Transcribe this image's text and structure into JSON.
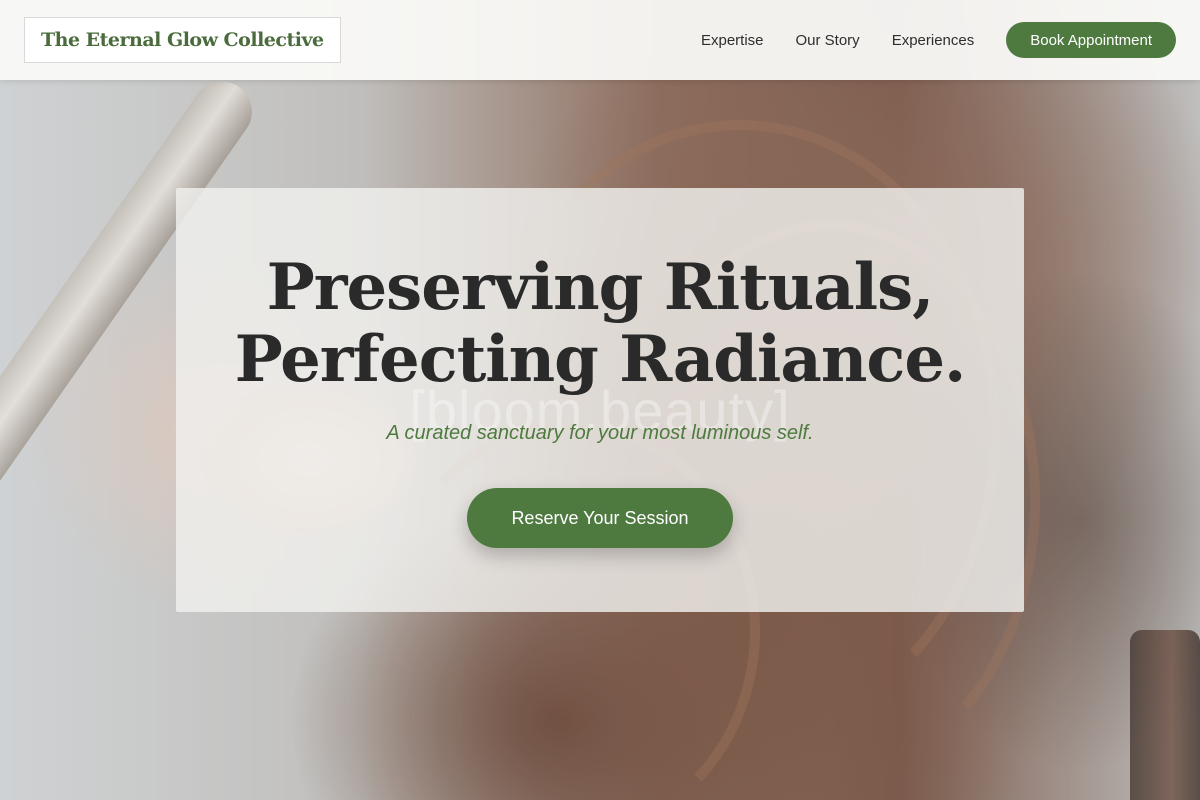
{
  "header": {
    "brand": "The Eternal Glow Collective",
    "nav": [
      {
        "label": "Expertise"
      },
      {
        "label": "Our Story"
      },
      {
        "label": "Experiences"
      }
    ],
    "cta_label": "Book Appointment"
  },
  "hero": {
    "headline_line1": "Preserving Rituals,",
    "headline_line2": "Perfecting Radiance.",
    "watermark": "[bloom.beauty]",
    "tagline": "A curated sanctuary for your most luminous self.",
    "cta_label": "Reserve Your Session",
    "background_image": "hair-styling-photo"
  },
  "colors": {
    "accent": "#4e7a40",
    "heading": "#2a2a2a",
    "header_bg": "#fafaf8"
  }
}
